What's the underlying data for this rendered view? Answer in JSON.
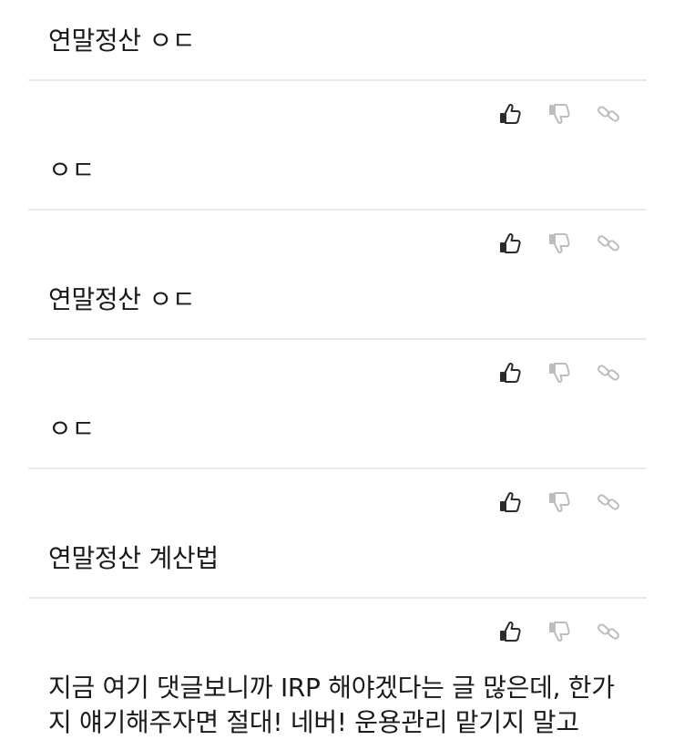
{
  "items": [
    {
      "text": "연말정산 ㅇㄷ"
    },
    {
      "text": "ㅇㄷ"
    },
    {
      "text": "연말정산 ㅇㄷ"
    },
    {
      "text": "ㅇㄷ"
    },
    {
      "text": "연말정산 계산법"
    },
    {
      "text": "지금 여기 댓글보니까 IRP 해야겠다는 글 많은데, 한가지 얘기해주자면 절대! 네버! 운용관리 맡기지 말고"
    }
  ],
  "icons": {
    "like": "thumbs-up-icon",
    "dislike": "thumbs-down-icon",
    "link": "link-icon"
  },
  "colors": {
    "like": "#2b2b2b",
    "dislike": "#bdbdbd",
    "link": "#bdbdbd",
    "divider": "#e9e9e9"
  }
}
